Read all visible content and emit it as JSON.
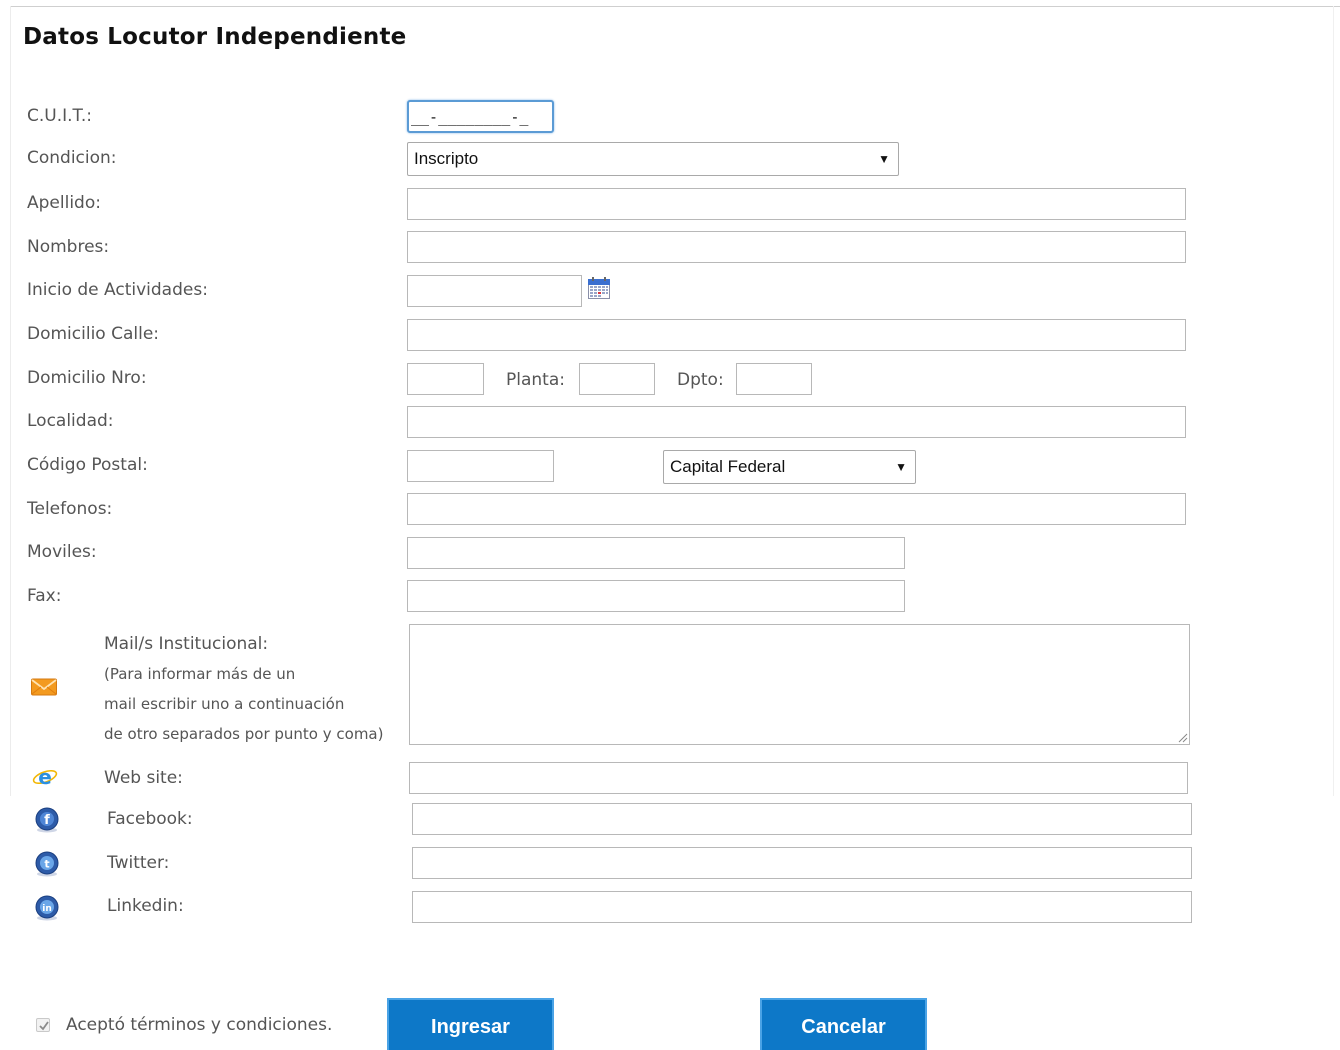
{
  "form": {
    "title": "Datos Locutor Independiente",
    "cuit": {
      "label": "C.U.I.T.:",
      "value": "__-________-_"
    },
    "condicion": {
      "label": "Condicion:",
      "selected": "Inscripto"
    },
    "apellido": {
      "label": "Apellido:"
    },
    "nombres": {
      "label": "Nombres:"
    },
    "inicio_actividades": {
      "label": "Inicio de Actividades:"
    },
    "domicilio_calle": {
      "label": "Domicilio Calle:"
    },
    "domicilio_nro": {
      "label": "Domicilio Nro:",
      "planta_label": "Planta:",
      "dpto_label": "Dpto:"
    },
    "localidad": {
      "label": "Localidad:"
    },
    "codigo_postal": {
      "label": "Código Postal:",
      "provincia_selected": "Capital Federal"
    },
    "telefonos": {
      "label": "Telefonos:"
    },
    "moviles": {
      "label": "Moviles:"
    },
    "fax": {
      "label": "Fax:"
    },
    "mail": {
      "label": "Mail/s Institucional:",
      "hint_line1": "(Para informar más de un",
      "hint_line2": "mail escribir uno a continuación",
      "hint_line3": "de otro separados por punto y coma)"
    },
    "website": {
      "label": "Web site:"
    },
    "facebook": {
      "label": "Facebook:"
    },
    "twitter": {
      "label": "Twitter:"
    },
    "linkedin": {
      "label": "Linkedin:"
    },
    "terms": {
      "label": "Aceptó términos y condiciones.",
      "checked": true
    },
    "submit_label": "Ingresar",
    "cancel_label": "Cancelar"
  },
  "icons": {
    "calendar": "calendar-icon",
    "mail": "envelope-icon",
    "website": "internet-explorer-icon",
    "facebook": "facebook-icon",
    "twitter": "twitter-icon",
    "linkedin": "linkedin-icon"
  },
  "colors": {
    "button_bg": "#0d78c8",
    "button_border": "#4aa3e6",
    "focus_border": "#5b9bd5"
  }
}
